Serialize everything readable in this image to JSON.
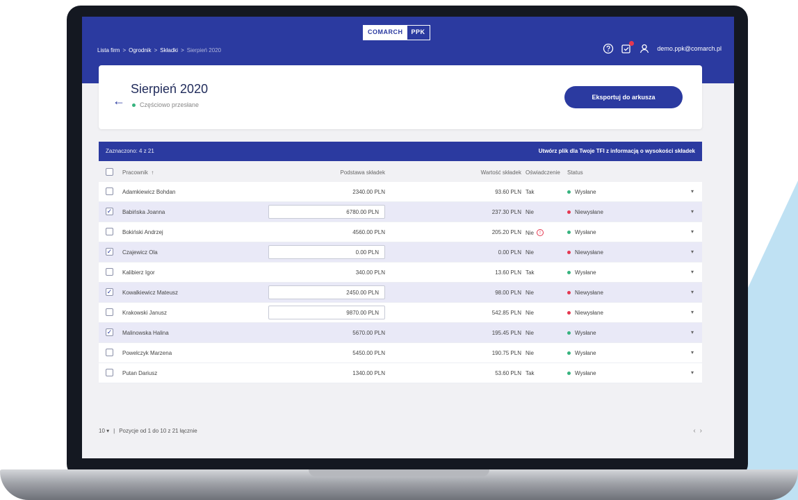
{
  "brand": {
    "left": "COMARCH",
    "right": "PPK"
  },
  "breadcrumb": [
    "Lista firm",
    "Ogrodnik",
    "Składki",
    "Sierpień 2020"
  ],
  "breadcrumb_sep": ">",
  "user": {
    "email": "demo.ppk@comarch.pl"
  },
  "header": {
    "title": "Sierpień 2020",
    "status": "Częściowo przesłane",
    "export_label": "Eksportuj do arkusza"
  },
  "selection": {
    "count_text": "Zaznaczono: 4 z 21",
    "action_text": "Utwórz plik dla Twoje TFI z informacją o wysokości składek"
  },
  "columns": {
    "employee": "Pracownik",
    "sort_icon": "↑",
    "base": "Podstawa składek",
    "value": "Wartość składek",
    "declaration": "Oświadczenie",
    "status": "Status"
  },
  "rows": [
    {
      "name": "Adamkiewicz Bohdan",
      "base": "2340.00 PLN",
      "value": "93.60 PLN",
      "decl": "Tak",
      "status": "Wysłane"
    },
    {
      "name": "Babińska Joanna",
      "base": "6780.00 PLN",
      "value": "237.30 PLN",
      "decl": "Nie",
      "status": "Niewysłane"
    },
    {
      "name": "Bokiński Andrzej",
      "base": "4560.00 PLN",
      "value": "205.20 PLN",
      "decl": "Nie",
      "status": "Wysłane"
    },
    {
      "name": "Czajewicz Ola",
      "base": "0.00 PLN",
      "value": "0.00 PLN",
      "decl": "Nie",
      "status": "Niewysłane"
    },
    {
      "name": "Kalibierz Igor",
      "base": "340.00 PLN",
      "value": "13.60 PLN",
      "decl": "Tak",
      "status": "Wysłane"
    },
    {
      "name": "Kowalkiewicz Mateusz",
      "base": "2450.00 PLN",
      "value": "98.00 PLN",
      "decl": "Nie",
      "status": "Niewysłane"
    },
    {
      "name": "Krakowski Janusz",
      "base": "9870.00 PLN",
      "value": "542.85 PLN",
      "decl": "Nie",
      "status": "Niewysłane"
    },
    {
      "name": "Malinowska Halina",
      "base": "5670.00 PLN",
      "value": "195.45 PLN",
      "decl": "Nie",
      "status": "Wysłane"
    },
    {
      "name": "Powelczyk Marzena",
      "base": "5450.00 PLN",
      "value": "190.75 PLN",
      "decl": "Nie",
      "status": "Wysłane"
    },
    {
      "name": "Putan Dariusz",
      "base": "1340.00 PLN",
      "value": "53.60 PLN",
      "decl": "Tak",
      "status": "Wysłane"
    }
  ],
  "footer": {
    "page_size": "10 ▾",
    "range_text": "Pozycje od 1 do 10 z 21 łącznie",
    "prev": "‹",
    "next": "›"
  },
  "colors": {
    "primary": "#2b3aa0",
    "sent": "#36b37e",
    "not_sent": "#e53750",
    "selected_row": "#e9e9f7"
  },
  "icons": [
    "help-icon",
    "notifications-icon",
    "user-icon",
    "back-arrow-icon",
    "chevron-down-icon",
    "warning-icon"
  ]
}
